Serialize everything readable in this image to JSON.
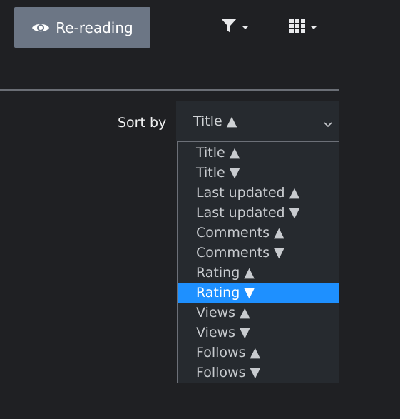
{
  "toolbar": {
    "reread_label": "Re-reading",
    "icons": {
      "reread": "eye-icon",
      "filter": "filter-icon",
      "view": "grid-icon"
    }
  },
  "sort": {
    "label": "Sort by",
    "selected_value": "Title ▲",
    "options": [
      {
        "label": "Title ▲",
        "highlighted": false
      },
      {
        "label": "Title ▼",
        "highlighted": false
      },
      {
        "label": "Last updated ▲",
        "highlighted": false
      },
      {
        "label": "Last updated ▼",
        "highlighted": false
      },
      {
        "label": "Comments ▲",
        "highlighted": false
      },
      {
        "label": "Comments ▼",
        "highlighted": false
      },
      {
        "label": "Rating ▲",
        "highlighted": false
      },
      {
        "label": "Rating ▼",
        "highlighted": true
      },
      {
        "label": "Views ▲",
        "highlighted": false
      },
      {
        "label": "Views ▼",
        "highlighted": false
      },
      {
        "label": "Follows ▲",
        "highlighted": false
      },
      {
        "label": "Follows ▼",
        "highlighted": false
      }
    ]
  },
  "colors": {
    "background": "#1f2023",
    "button": "#6c7685",
    "highlight": "#1e90ff",
    "select_bg": "#262a2f"
  }
}
